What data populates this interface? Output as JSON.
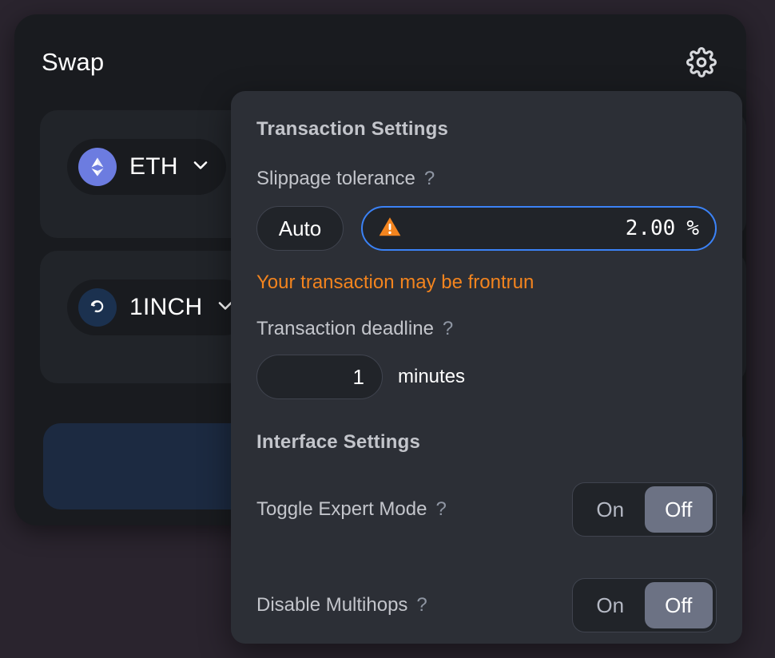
{
  "app": {
    "title": "Swap",
    "settings_icon": "gear-icon"
  },
  "tokens": {
    "from": {
      "symbol": "ETH",
      "logo": "eth-logo-icon",
      "chevron": "chevron-down-icon"
    },
    "to": {
      "symbol": "1INCH",
      "logo": "1inch-logo-icon",
      "chevron": "chevron-down-icon"
    }
  },
  "action_button": {
    "label": ""
  },
  "settings": {
    "transaction_title": "Transaction Settings",
    "slippage": {
      "label": "Slippage tolerance",
      "help": "?",
      "auto_label": "Auto",
      "value": "2.00",
      "unit": "%",
      "warning_icon": "warning-triangle-icon",
      "warning_text": "Your transaction may be frontrun"
    },
    "deadline": {
      "label": "Transaction deadline",
      "help": "?",
      "value": "1",
      "unit": "minutes"
    },
    "interface_title": "Interface Settings",
    "expert_mode": {
      "label": "Toggle Expert Mode",
      "help": "?",
      "on_label": "On",
      "off_label": "Off",
      "state": "Off"
    },
    "multihops": {
      "label": "Disable Multihops",
      "help": "?",
      "on_label": "On",
      "off_label": "Off",
      "state": "Off"
    }
  },
  "colors": {
    "page_bg": "#2a242e",
    "card_bg": "#191b1f",
    "panel_bg": "#212429",
    "popover_bg": "#2c2f36",
    "accent_blue": "#3b82f6",
    "warning_orange": "#f3841e",
    "toggle_active": "#6c7284",
    "action_button": "#1c2a41"
  }
}
